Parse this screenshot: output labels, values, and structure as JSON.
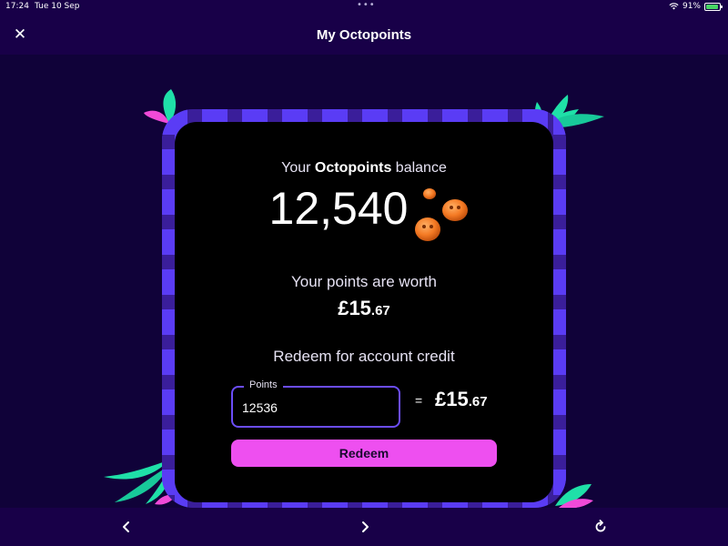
{
  "status_bar": {
    "time": "17:24",
    "date": "Tue 10 Sep",
    "battery": "91%"
  },
  "header": {
    "title": "My Octopoints",
    "close_icon": "close-icon"
  },
  "balance": {
    "heading_prefix": "Your ",
    "heading_brand": "Octopoints",
    "heading_suffix": " balance",
    "value": "12,540"
  },
  "worth": {
    "heading": "Your points are worth",
    "value_main": "£15",
    "value_fraction": ".67"
  },
  "redeem": {
    "heading": "Redeem for account credit",
    "points_label": "Points",
    "points_value": "12536",
    "equals": "=",
    "credit_main": "£15",
    "credit_fraction": ".67",
    "button_label": "Redeem"
  },
  "toolbar": {
    "back_icon": "chevron-left-icon",
    "forward_icon": "chevron-right-icon",
    "reload_icon": "reload-icon"
  },
  "colors": {
    "background": "#100239",
    "header": "#180048",
    "frame_primary": "#5a3cf5",
    "frame_secondary": "#3a1e9a",
    "card": "#000000",
    "accent_button": "#ee4ff0",
    "input_border": "#6b4df7",
    "leaf_green": "#1fe0a8",
    "leaf_pink": "#f04ad8"
  }
}
